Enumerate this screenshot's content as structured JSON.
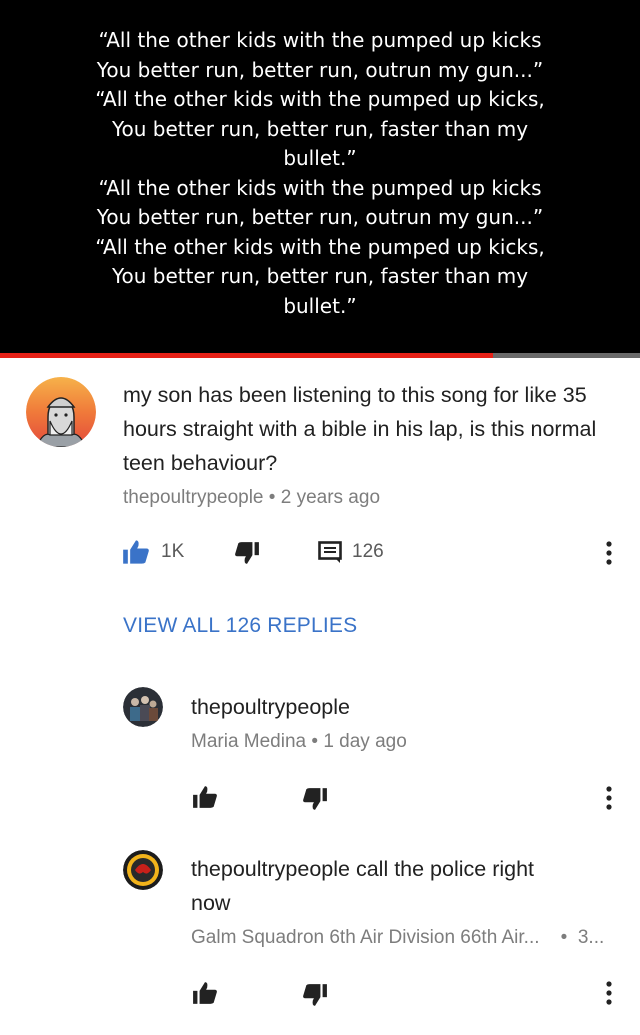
{
  "video": {
    "lyrics_lines": [
      "“All the other kids with the pumped up kicks",
      "You better run, better run, outrun my gun...”",
      "“All the other kids with the pumped up kicks,",
      "You better run, better run, faster than my",
      "bullet.”",
      "“All the other kids with the pumped up kicks",
      "You better run, better run, outrun my gun...”",
      "“All the other kids with the pumped up kicks,",
      "You better run, better run, faster than my",
      "bullet.”"
    ],
    "progress_fraction": 0.77,
    "progress_color": "#e62117"
  },
  "comment": {
    "text": "my son has been listening to this song for like 35 hours straight with a bible in his lap, is this normal teen behaviour?",
    "author": "thepoultrypeople",
    "time": "2 years ago",
    "like_count": "1K",
    "reply_count": "126",
    "view_replies_label": "VIEW ALL 126 REPLIES",
    "liked": true
  },
  "replies": [
    {
      "text": "thepoultrypeople",
      "author": "Maria Medina",
      "time": "1 day ago"
    },
    {
      "text_line1": "thepoultrypeople call the police right",
      "text_line2": "now",
      "author": "Galm Squadron 6th Air Division 66th Air...",
      "time": "3..."
    }
  ],
  "colors": {
    "accent_blue": "#3a73c8",
    "icon_dark": "#222222"
  },
  "icons": {
    "like": "thumbs-up-icon",
    "dislike": "thumbs-down-icon",
    "reply": "comment-icon",
    "more": "more-vert-icon"
  }
}
